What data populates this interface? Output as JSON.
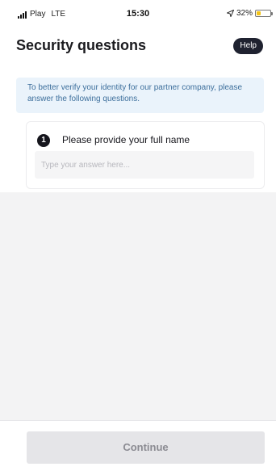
{
  "status_bar": {
    "carrier": "Play",
    "network": "LTE",
    "time": "15:30",
    "location_icon": "location-arrow-icon",
    "battery_percent_label": "32%",
    "battery_level": 0.32,
    "battery_color": "#f3c316"
  },
  "header": {
    "title": "Security questions",
    "help_label": "Help"
  },
  "info": {
    "text": "To better verify your identity for our partner company, please answer the following questions."
  },
  "questions": [
    {
      "number": "1",
      "label": "Please provide your full name",
      "value": "",
      "placeholder": "Type your answer here..."
    }
  ],
  "footer": {
    "continue_label": "Continue"
  },
  "colors": {
    "info_background": "#eaf3fb",
    "info_text": "#3d6f9c",
    "help_button": "#1f2230",
    "continue_disabled": "#e5e5e8"
  }
}
